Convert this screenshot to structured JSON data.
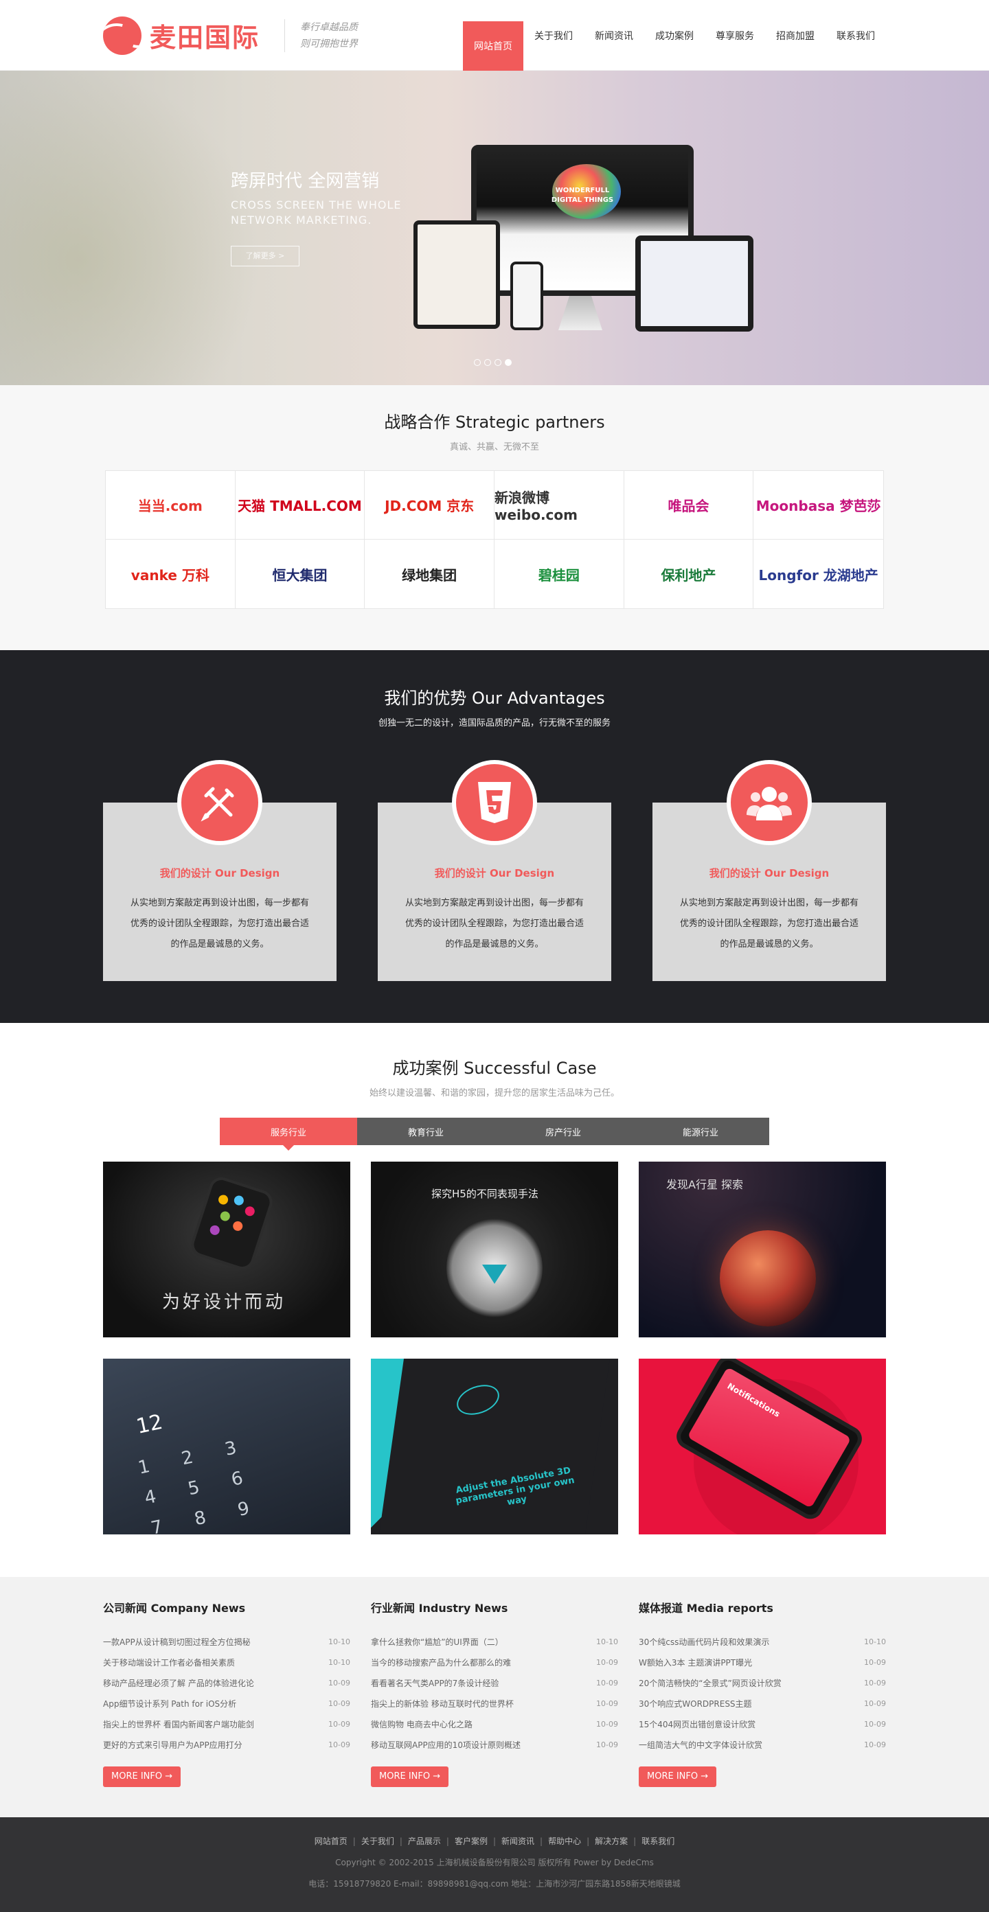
{
  "header": {
    "logo_text": "麦田国际",
    "slogan_line1": "奉行卓越品质",
    "slogan_line2": "则可拥抱世界",
    "nav": [
      "网站首页",
      "关于我们",
      "新闻资讯",
      "成功案例",
      "尊享服务",
      "招商加盟",
      "联系我们"
    ]
  },
  "banner": {
    "title": "跨屏时代  全网营销",
    "subtitle_line1": "CROSS SCREEN THE WHOLE",
    "subtitle_line2": "NETWORK MARKETING.",
    "button": "了解更多 >",
    "screen_text_line1": "WONDERFULL",
    "screen_text_line2": "DIGITAL THINGS",
    "slides": 4,
    "active_slide": 4
  },
  "partners": {
    "title": "战略合作 Strategic partners",
    "subtitle": "真诚、共赢、无微不至",
    "logos": [
      {
        "name": "dangdang.com",
        "text": "当当.com",
        "color": "#e8352e"
      },
      {
        "name": "tmall",
        "text": "天猫 TMALL.COM",
        "color": "#d0021b"
      },
      {
        "name": "jd",
        "text": "JD.COM 京东",
        "color": "#e1251b"
      },
      {
        "name": "weibo",
        "text": "新浪微博 weibo.com",
        "color": "#333333"
      },
      {
        "name": "vip",
        "text": "唯品会",
        "color": "#c6177e"
      },
      {
        "name": "moonbasa",
        "text": "Moonbasa 梦芭莎",
        "color": "#c6177e"
      },
      {
        "name": "vanke",
        "text": "vanke 万科",
        "color": "#e1251b"
      },
      {
        "name": "evergrande",
        "text": "恒大集团",
        "color": "#1f2a6d"
      },
      {
        "name": "greenland",
        "text": "绿地集团",
        "color": "#222222"
      },
      {
        "name": "country-garden",
        "text": "碧桂园",
        "color": "#1a8f3c"
      },
      {
        "name": "poly",
        "text": "保利地产",
        "color": "#1a7a3a"
      },
      {
        "name": "longfor",
        "text": "Longfor 龙湖地产",
        "color": "#2a3b8f"
      }
    ]
  },
  "advantages": {
    "title": "我们的优势 Our Advantages",
    "subtitle": "创独一无二的设计，造国际品质的产品，行无微不至的服务",
    "cards": [
      {
        "name": "我们的设计 Our Design",
        "icon": "design-tools-icon",
        "desc": "从实地到方案敲定再到设计出图，每一步都有优秀的设计团队全程跟踪，为您打造出最合适的作品是最诚恳的义务。"
      },
      {
        "name": "我们的设计 Our Design",
        "icon": "html5-icon",
        "desc": "从实地到方案敲定再到设计出图，每一步都有优秀的设计团队全程跟踪，为您打造出最合适的作品是最诚恳的义务。"
      },
      {
        "name": "我们的设计 Our Design",
        "icon": "team-icon",
        "desc": "从实地到方案敲定再到设计出图，每一步都有优秀的设计团队全程跟踪，为您打造出最合适的作品是最诚恳的义务。"
      }
    ]
  },
  "cases": {
    "title": "成功案例 Successful Case",
    "subtitle": "始终以建设温馨、和谐的家园，提升您的居家生活品味为己任。",
    "tabs": [
      "服务行业",
      "教育行业",
      "房产行业",
      "能源行业"
    ],
    "items": [
      {
        "caption": "为好设计而动"
      },
      {
        "caption": "探究H5的不同表现手法"
      },
      {
        "caption": "发现A行星 探索"
      },
      {
        "caption": "12"
      },
      {
        "caption": "Adjust the Absolute 3D parameters in your own way"
      },
      {
        "caption": "Notifications"
      }
    ]
  },
  "news": {
    "more_label": "MORE INFO →",
    "columns": [
      {
        "title": "公司新闻 Company News",
        "items": [
          {
            "t": "一款APP从设计稿到切图过程全方位揭秘",
            "d": "10-10"
          },
          {
            "t": "关于移动端设计工作者必备相关素质",
            "d": "10-10"
          },
          {
            "t": "移动产品经理必须了解 产品的体验进化论",
            "d": "10-09"
          },
          {
            "t": "App细节设计系列 Path for iOS分析",
            "d": "10-09"
          },
          {
            "t": "指尖上的世界杯 看国内新闻客户端功能剑",
            "d": "10-09"
          },
          {
            "t": "更好的方式来引导用户为APP应用打分",
            "d": "10-09"
          }
        ]
      },
      {
        "title": "行业新闻 Industry News",
        "items": [
          {
            "t": "拿什么拯救你“尴尬”的UI界面（二）",
            "d": "10-10"
          },
          {
            "t": "当今的移动搜索产品为什么都那么的难",
            "d": "10-09"
          },
          {
            "t": "看看著名天气类APP的7条设计经验",
            "d": "10-09"
          },
          {
            "t": "指尖上的新体验 移动互联时代的世界杯",
            "d": "10-09"
          },
          {
            "t": "微信购物 电商去中心化之路",
            "d": "10-09"
          },
          {
            "t": "移动互联网APP应用的10项设计原则概述",
            "d": "10-09"
          }
        ]
      },
      {
        "title": "媒体报道 Media reports",
        "items": [
          {
            "t": "30个纯css动画代码片段和效果演示",
            "d": "10-10"
          },
          {
            "t": "W额始入3本 主题演讲PPT曝光",
            "d": "10-09"
          },
          {
            "t": "20个简洁畅快的“全景式”网页设计欣赏",
            "d": "10-09"
          },
          {
            "t": "30个响应式WORDPRESS主题",
            "d": "10-09"
          },
          {
            "t": "15个404网页出错创意设计欣赏",
            "d": "10-09"
          },
          {
            "t": "一组简洁大气的中文字体设计欣赏",
            "d": "10-09"
          }
        ]
      }
    ]
  },
  "footer": {
    "links": [
      "网站首页",
      "关于我们",
      "产品展示",
      "客户案例",
      "新闻资讯",
      "帮助中心",
      "解决方案",
      "联系我们"
    ],
    "copyright": "Copyright © 2002-2015 上海机械设备股份有限公司 版权所有 Power by DedeCms",
    "contact": "电话：15918779820 E-mail：89898981@qq.com 地址：上海市沙河广园东路1858新天地眼镜城"
  },
  "colors": {
    "accent": "#f15a5a",
    "dark": "#212226",
    "footer": "#333335"
  }
}
